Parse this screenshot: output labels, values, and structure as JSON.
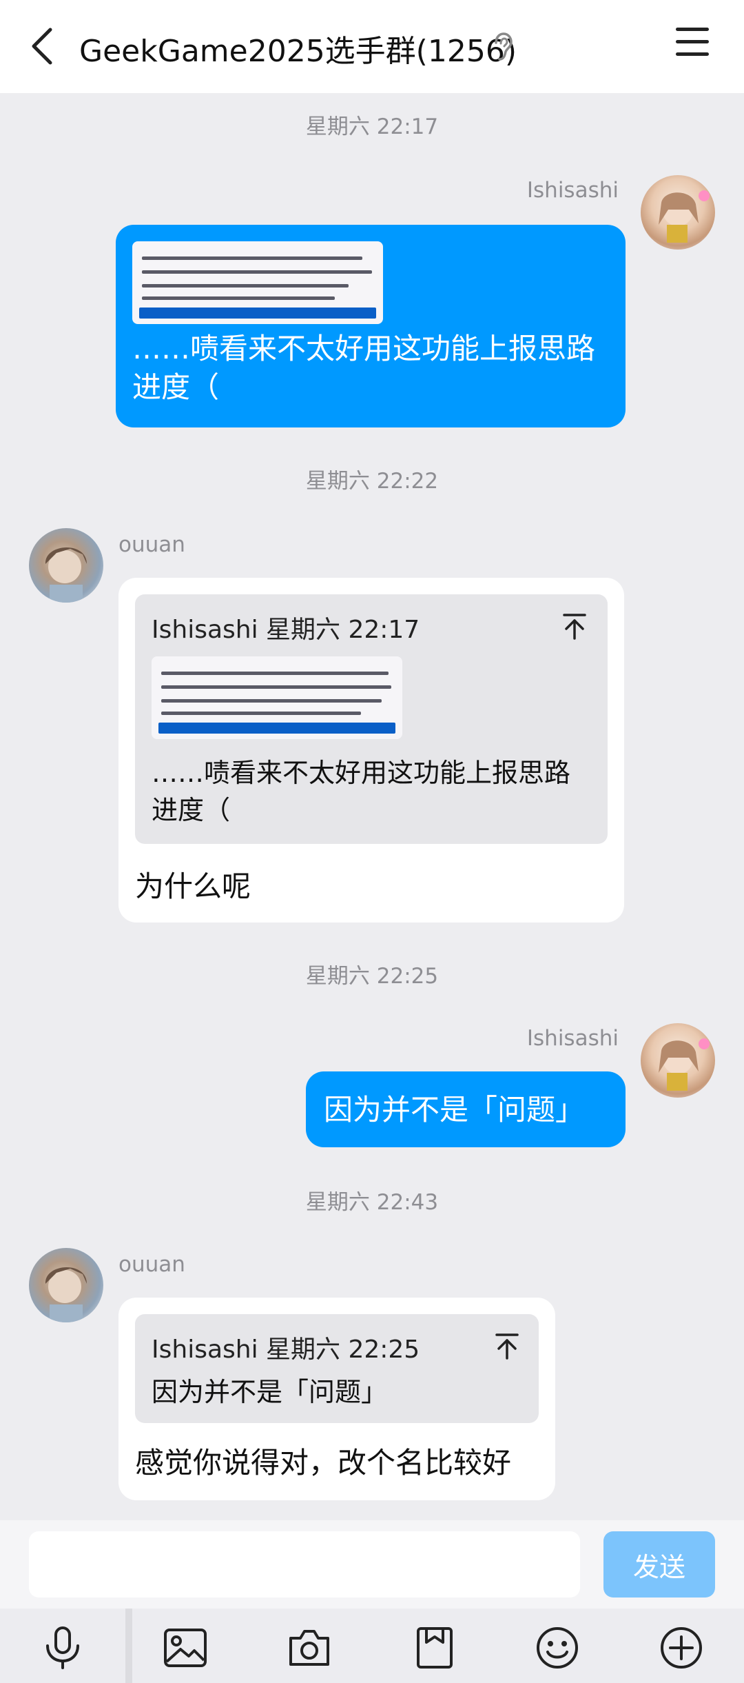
{
  "header": {
    "title": "GeekGame2025选手群(1256)"
  },
  "messages": [
    {
      "timestamp": "星期六 22:17",
      "sender": "Ishisashi",
      "text": "……啧看来不太好用这功能上报思路进度（"
    },
    {
      "timestamp": "星期六 22:22",
      "sender": "ouuan",
      "quote_header": "Ishisashi 星期六 22:17",
      "quote_text": " ……啧看来不太好用这功能上报思路进度（",
      "text": "为什么呢"
    },
    {
      "timestamp": "星期六 22:25",
      "sender": "Ishisashi",
      "text": "因为并不是「问题」"
    },
    {
      "timestamp": "星期六 22:43",
      "sender": "ouuan",
      "quote_header": "Ishisashi 星期六 22:25",
      "quote_text": "因为并不是「问题」",
      "text": "感觉你说得对，改个名比较好"
    }
  ],
  "composer": {
    "input_value": "",
    "send_label": "发送"
  },
  "toolbar_icons": [
    "microphone-icon",
    "image-icon",
    "camera-icon",
    "file-icon",
    "emoji-icon",
    "plus-icon"
  ],
  "colors": {
    "outgoing_bubble": "#0099ff",
    "incoming_bubble": "#ffffff",
    "background": "#ededf0",
    "send_button": "#7cc4fc"
  }
}
